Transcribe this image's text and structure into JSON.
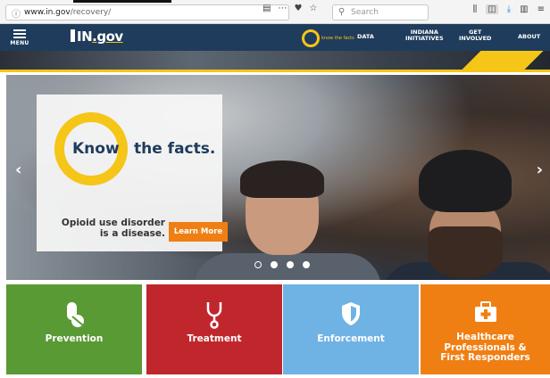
{
  "browser": {
    "url_domain": "www.in.gov",
    "url_path": "/recovery/",
    "info_icon": "info-circle-icon",
    "search_placeholder": "Search",
    "page_actions": [
      "reader-view-icon",
      "page-menu-icon",
      "pocket-icon",
      "bookmark-star-icon"
    ],
    "toolbar_icons": [
      "library-icon",
      "sidebar-icon",
      "downloads-icon",
      "reader-icon",
      "hamburger-menu-icon"
    ]
  },
  "header": {
    "menu_label": "MENU",
    "logo_text": "IN",
    "logo_suffix": ".gov",
    "badge_text": "know the facts",
    "nav": [
      {
        "line1": "DATA",
        "line2": ""
      },
      {
        "line1": "INDIANA",
        "line2": "INITIATIVES"
      },
      {
        "line1": "GET",
        "line2": "INVOLVED"
      },
      {
        "line1": "ABOUT",
        "line2": ""
      }
    ]
  },
  "hero": {
    "know": "Know",
    "facts": "the facts.",
    "message_line1": "Opioid use disorder",
    "message_line2": "is a disease.",
    "cta": "Learn More",
    "prev": "‹",
    "next": "›",
    "slides": 4,
    "active_slide": 2
  },
  "tiles": [
    {
      "label_lines": [
        "Prevention"
      ],
      "icon": "pill-icon",
      "color": "#5a9a35"
    },
    {
      "label_lines": [
        "Treatment"
      ],
      "icon": "stethoscope-icon",
      "color": "#c0272d"
    },
    {
      "label_lines": [
        "Enforcement"
      ],
      "icon": "shield-icon",
      "color": "#6fb2e4"
    },
    {
      "label_lines": [
        "Healthcare",
        "Professionals &",
        "First Responders"
      ],
      "icon": "first-aid-kit-icon",
      "color": "#f07f13"
    }
  ]
}
